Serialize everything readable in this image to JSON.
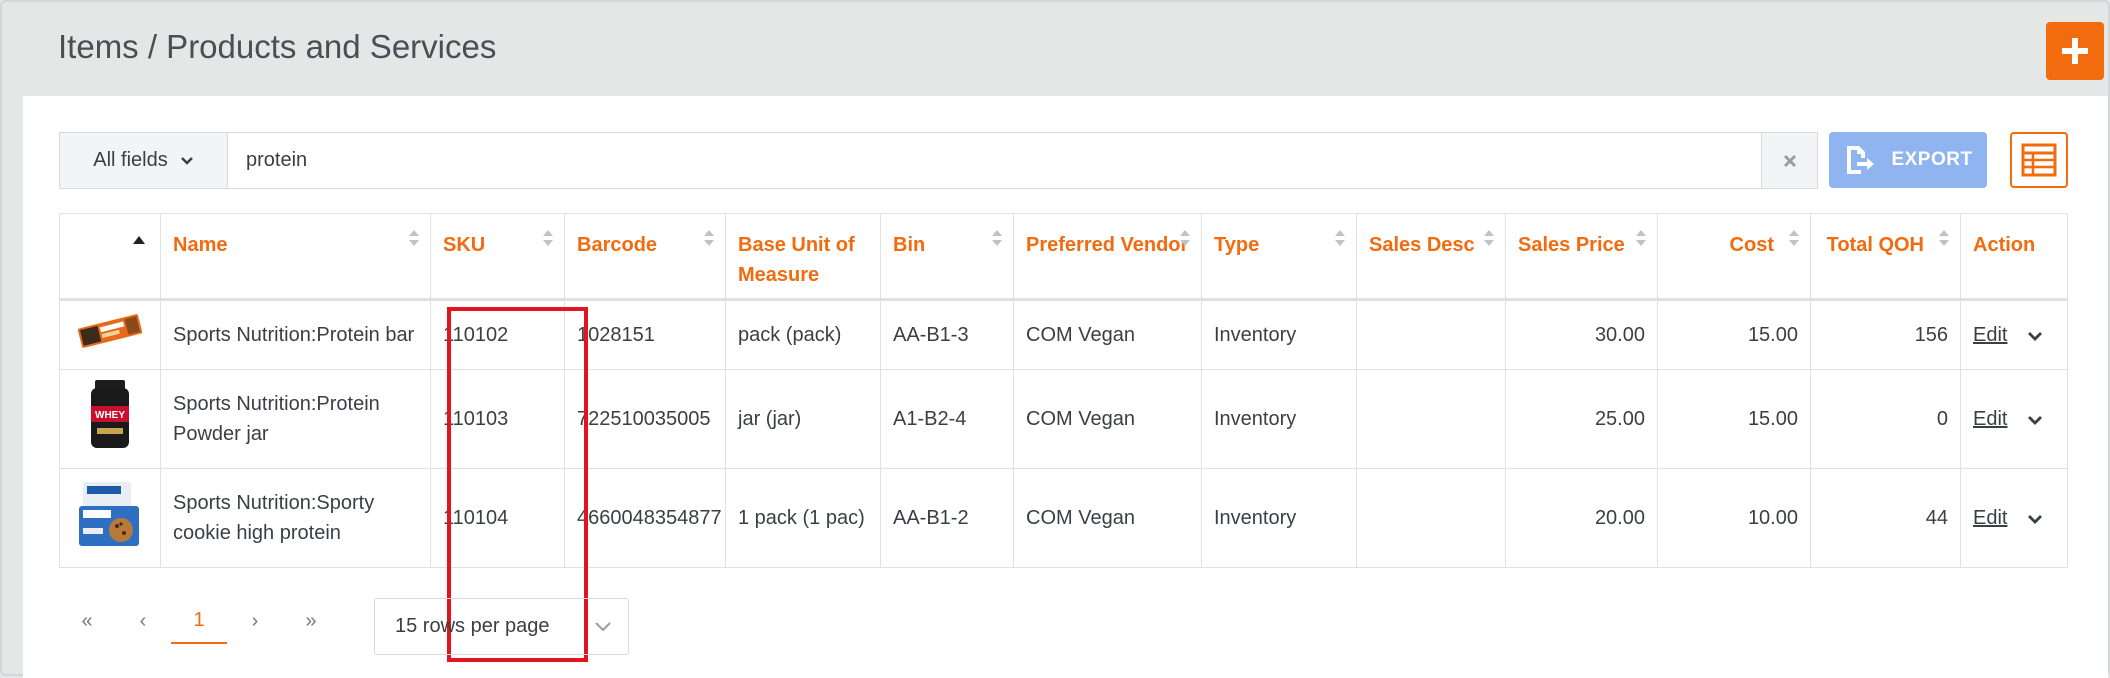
{
  "page": {
    "title": "Items / Products and Services",
    "accent_color": "#f26b0f"
  },
  "toolbar": {
    "field_filter": "All fields",
    "search_value": "protein",
    "export_label": "EXPORT",
    "add_icon": "plus-icon",
    "columns_icon": "table-columns-icon"
  },
  "table": {
    "columns": [
      "",
      "Name",
      "SKU",
      "Barcode",
      "Base Unit of Measure",
      "Bin",
      "Preferred Vendor",
      "Type",
      "Sales Desc",
      "Sales Price",
      "Cost",
      "Total QOH",
      "Action"
    ],
    "rows": [
      {
        "image": "protein-bar-thumbnail",
        "name": "Sports Nutrition:Protein bar",
        "sku": "110102",
        "barcode": "1028151",
        "unit": "pack (pack)",
        "bin": "AA-B1-3",
        "vendor": "COM Vegan",
        "type": "Inventory",
        "sales_desc": "",
        "sales_price": "30.00",
        "cost": "15.00",
        "qoh": "156",
        "action": "Edit"
      },
      {
        "image": "whey-jar-thumbnail",
        "name": "Sports Nutrition:Protein Powder jar",
        "sku": "110103",
        "barcode": "722510035005",
        "unit": "jar (jar)",
        "bin": "A1-B2-4",
        "vendor": "COM Vegan",
        "type": "Inventory",
        "sales_desc": "",
        "sales_price": "25.00",
        "cost": "15.00",
        "qoh": "0",
        "action": "Edit"
      },
      {
        "image": "cookie-box-thumbnail",
        "name": "Sports Nutrition:Sporty cookie high protein",
        "sku": "110104",
        "barcode": "4660048354877",
        "unit": "1 pack (1 pac)",
        "bin": "AA-B1-2",
        "vendor": "COM Vegan",
        "type": "Inventory",
        "sales_desc": "",
        "sales_price": "20.00",
        "cost": "10.00",
        "qoh": "44",
        "action": "Edit"
      }
    ]
  },
  "pagination": {
    "first": "«",
    "prev": "‹",
    "current": "1",
    "next": "›",
    "last": "»",
    "rows_per_page": "15 rows per page"
  }
}
